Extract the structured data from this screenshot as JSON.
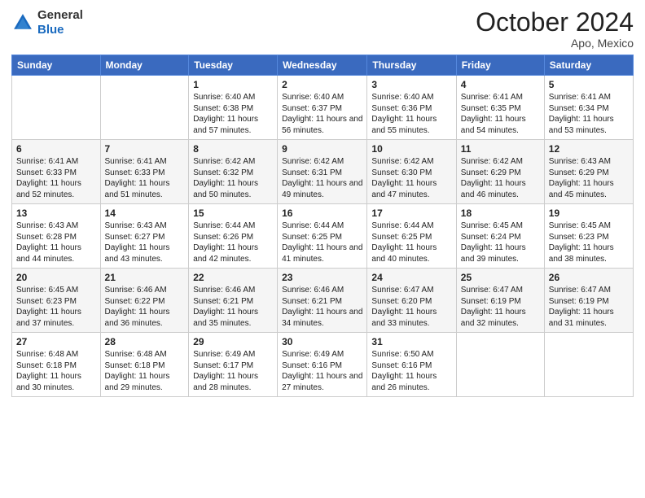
{
  "header": {
    "logo_general": "General",
    "logo_blue": "Blue",
    "month_title": "October 2024",
    "location": "Apo, Mexico"
  },
  "weekdays": [
    "Sunday",
    "Monday",
    "Tuesday",
    "Wednesday",
    "Thursday",
    "Friday",
    "Saturday"
  ],
  "weeks": [
    [
      null,
      null,
      {
        "day": "1",
        "sunrise": "6:40 AM",
        "sunset": "6:38 PM",
        "daylight": "11 hours and 57 minutes."
      },
      {
        "day": "2",
        "sunrise": "6:40 AM",
        "sunset": "6:37 PM",
        "daylight": "11 hours and 56 minutes."
      },
      {
        "day": "3",
        "sunrise": "6:40 AM",
        "sunset": "6:36 PM",
        "daylight": "11 hours and 55 minutes."
      },
      {
        "day": "4",
        "sunrise": "6:41 AM",
        "sunset": "6:35 PM",
        "daylight": "11 hours and 54 minutes."
      },
      {
        "day": "5",
        "sunrise": "6:41 AM",
        "sunset": "6:34 PM",
        "daylight": "11 hours and 53 minutes."
      }
    ],
    [
      {
        "day": "6",
        "sunrise": "6:41 AM",
        "sunset": "6:33 PM",
        "daylight": "11 hours and 52 minutes."
      },
      {
        "day": "7",
        "sunrise": "6:41 AM",
        "sunset": "6:33 PM",
        "daylight": "11 hours and 51 minutes."
      },
      {
        "day": "8",
        "sunrise": "6:42 AM",
        "sunset": "6:32 PM",
        "daylight": "11 hours and 50 minutes."
      },
      {
        "day": "9",
        "sunrise": "6:42 AM",
        "sunset": "6:31 PM",
        "daylight": "11 hours and 49 minutes."
      },
      {
        "day": "10",
        "sunrise": "6:42 AM",
        "sunset": "6:30 PM",
        "daylight": "11 hours and 47 minutes."
      },
      {
        "day": "11",
        "sunrise": "6:42 AM",
        "sunset": "6:29 PM",
        "daylight": "11 hours and 46 minutes."
      },
      {
        "day": "12",
        "sunrise": "6:43 AM",
        "sunset": "6:29 PM",
        "daylight": "11 hours and 45 minutes."
      }
    ],
    [
      {
        "day": "13",
        "sunrise": "6:43 AM",
        "sunset": "6:28 PM",
        "daylight": "11 hours and 44 minutes."
      },
      {
        "day": "14",
        "sunrise": "6:43 AM",
        "sunset": "6:27 PM",
        "daylight": "11 hours and 43 minutes."
      },
      {
        "day": "15",
        "sunrise": "6:44 AM",
        "sunset": "6:26 PM",
        "daylight": "11 hours and 42 minutes."
      },
      {
        "day": "16",
        "sunrise": "6:44 AM",
        "sunset": "6:25 PM",
        "daylight": "11 hours and 41 minutes."
      },
      {
        "day": "17",
        "sunrise": "6:44 AM",
        "sunset": "6:25 PM",
        "daylight": "11 hours and 40 minutes."
      },
      {
        "day": "18",
        "sunrise": "6:45 AM",
        "sunset": "6:24 PM",
        "daylight": "11 hours and 39 minutes."
      },
      {
        "day": "19",
        "sunrise": "6:45 AM",
        "sunset": "6:23 PM",
        "daylight": "11 hours and 38 minutes."
      }
    ],
    [
      {
        "day": "20",
        "sunrise": "6:45 AM",
        "sunset": "6:23 PM",
        "daylight": "11 hours and 37 minutes."
      },
      {
        "day": "21",
        "sunrise": "6:46 AM",
        "sunset": "6:22 PM",
        "daylight": "11 hours and 36 minutes."
      },
      {
        "day": "22",
        "sunrise": "6:46 AM",
        "sunset": "6:21 PM",
        "daylight": "11 hours and 35 minutes."
      },
      {
        "day": "23",
        "sunrise": "6:46 AM",
        "sunset": "6:21 PM",
        "daylight": "11 hours and 34 minutes."
      },
      {
        "day": "24",
        "sunrise": "6:47 AM",
        "sunset": "6:20 PM",
        "daylight": "11 hours and 33 minutes."
      },
      {
        "day": "25",
        "sunrise": "6:47 AM",
        "sunset": "6:19 PM",
        "daylight": "11 hours and 32 minutes."
      },
      {
        "day": "26",
        "sunrise": "6:47 AM",
        "sunset": "6:19 PM",
        "daylight": "11 hours and 31 minutes."
      }
    ],
    [
      {
        "day": "27",
        "sunrise": "6:48 AM",
        "sunset": "6:18 PM",
        "daylight": "11 hours and 30 minutes."
      },
      {
        "day": "28",
        "sunrise": "6:48 AM",
        "sunset": "6:18 PM",
        "daylight": "11 hours and 29 minutes."
      },
      {
        "day": "29",
        "sunrise": "6:49 AM",
        "sunset": "6:17 PM",
        "daylight": "11 hours and 28 minutes."
      },
      {
        "day": "30",
        "sunrise": "6:49 AM",
        "sunset": "6:16 PM",
        "daylight": "11 hours and 27 minutes."
      },
      {
        "day": "31",
        "sunrise": "6:50 AM",
        "sunset": "6:16 PM",
        "daylight": "11 hours and 26 minutes."
      },
      null,
      null
    ]
  ]
}
